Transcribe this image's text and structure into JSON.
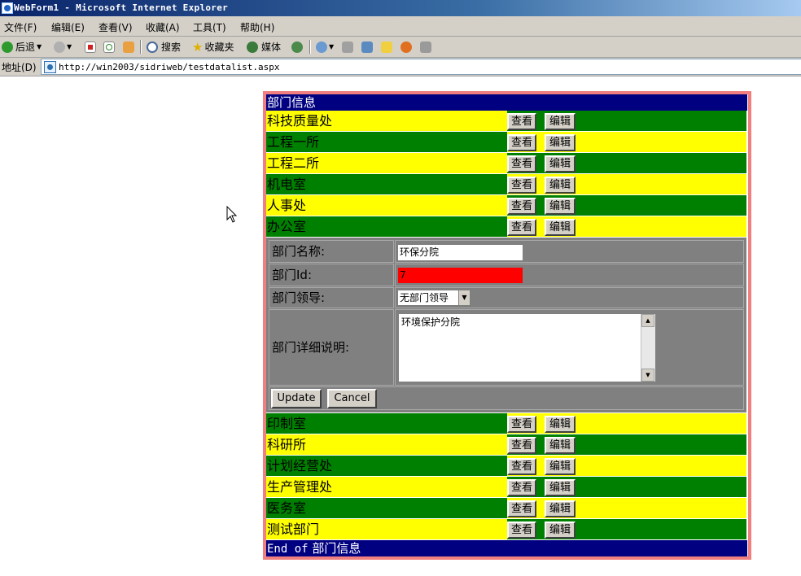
{
  "window": {
    "title": "WebForm1 - Microsoft Internet Explorer"
  },
  "menu": [
    {
      "label": "文件(F)"
    },
    {
      "label": "编辑(E)"
    },
    {
      "label": "查看(V)"
    },
    {
      "label": "收藏(A)"
    },
    {
      "label": "工具(T)"
    },
    {
      "label": "帮助(H)"
    }
  ],
  "toolbar": {
    "back_label": "后退",
    "search_label": "搜索",
    "favorites_label": "收藏夹",
    "media_label": "媒体"
  },
  "address": {
    "label": "地址(D)",
    "url": "http://win2003/sidriweb/testdatalist.aspx"
  },
  "datalist": {
    "header": "部门信息",
    "view_label": "查看",
    "edit_label": "编辑",
    "items_before": [
      {
        "name": "科技质量处",
        "style": "yellow"
      },
      {
        "name": "工程一所",
        "style": "green"
      },
      {
        "name": "工程二所",
        "style": "yellow"
      },
      {
        "name": "机电室",
        "style": "green"
      },
      {
        "name": "人事处",
        "style": "yellow"
      },
      {
        "name": "办公室",
        "style": "green"
      }
    ],
    "edit_item": {
      "name_label": "部门名称:",
      "name_value": "环保分院",
      "id_label": "部门Id:",
      "id_value": "7",
      "leader_label": "部门领导:",
      "leader_value": "无部门领导",
      "desc_label": "部门详细说明:",
      "desc_value": "环境保护分院",
      "update_label": "Update",
      "cancel_label": "Cancel"
    },
    "items_after": [
      {
        "name": "印制室",
        "style": "green"
      },
      {
        "name": "科研所",
        "style": "yellow"
      },
      {
        "name": "计划经营处",
        "style": "green"
      },
      {
        "name": "生产管理处",
        "style": "yellow"
      },
      {
        "name": "医务室",
        "style": "green"
      },
      {
        "name": "测试部门",
        "style": "yellow"
      }
    ],
    "footer_prefix": "End of",
    "footer_name": "部门信息"
  },
  "colors": {
    "header_bg": "#000080",
    "row_green": "#008000",
    "row_yellow": "#ffff00",
    "edit_bg": "#808080",
    "border": "#f08080",
    "id_field": "#ff0000"
  }
}
